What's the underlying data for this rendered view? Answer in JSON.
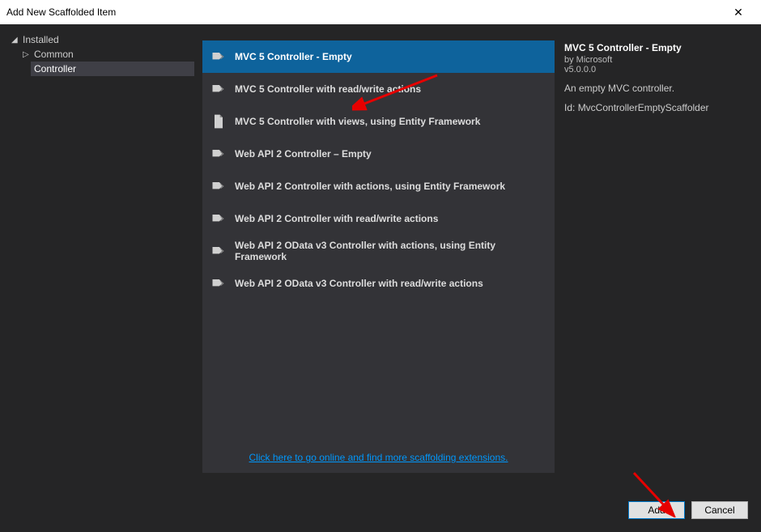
{
  "window": {
    "title": "Add New Scaffolded Item"
  },
  "sidebar": {
    "root": "Installed",
    "items": [
      {
        "label": "Common"
      },
      {
        "label": "Controller"
      }
    ]
  },
  "list": {
    "items": [
      {
        "label": "MVC 5 Controller - Empty",
        "icon": "controller",
        "selected": true
      },
      {
        "label": "MVC 5 Controller with read/write actions",
        "icon": "controller",
        "selected": false
      },
      {
        "label": "MVC 5 Controller with views, using Entity Framework",
        "icon": "file",
        "selected": false
      },
      {
        "label": "Web API 2 Controller – Empty",
        "icon": "controller",
        "selected": false
      },
      {
        "label": "Web API 2 Controller with actions, using Entity Framework",
        "icon": "controller",
        "selected": false
      },
      {
        "label": "Web API 2 Controller with read/write actions",
        "icon": "controller",
        "selected": false
      },
      {
        "label": "Web API 2 OData v3 Controller with actions, using Entity Framework",
        "icon": "controller",
        "selected": false
      },
      {
        "label": "Web API 2 OData v3 Controller with read/write actions",
        "icon": "controller",
        "selected": false
      }
    ],
    "online_link": "Click here to go online and find more scaffolding extensions."
  },
  "details": {
    "title": "MVC 5 Controller - Empty",
    "author": "by Microsoft",
    "version": "v5.0.0.0",
    "description": "An empty MVC controller.",
    "id_label": "Id:",
    "id_value": "MvcControllerEmptyScaffolder"
  },
  "footer": {
    "add": "Add",
    "cancel": "Cancel"
  }
}
